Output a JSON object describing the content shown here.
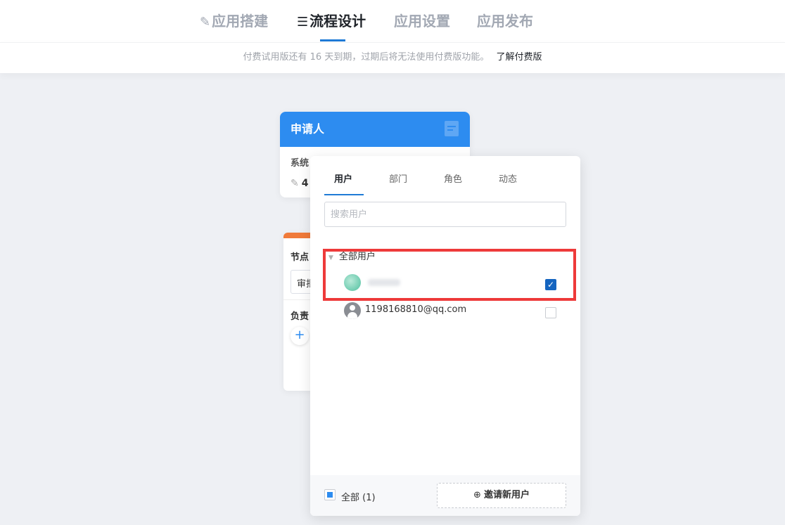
{
  "nav": {
    "tabs": [
      {
        "label": "应用搭建",
        "icon": "edit-icon",
        "active": false
      },
      {
        "label": "流程设计",
        "icon": "menu-icon",
        "active": true
      },
      {
        "label": "应用设置",
        "active": false
      },
      {
        "label": "应用发布",
        "active": false
      }
    ],
    "accent": "#1f7bd6"
  },
  "trial": {
    "message": "付费试用版还有 16 天到期，过期后将无法使用付费版功能。",
    "link": "了解付费版"
  },
  "applicant_card": {
    "title": "申请人",
    "line1": "系统",
    "line2": "4",
    "header_color": "#2d8cf0"
  },
  "node_card": {
    "label1": "节点",
    "box_value": "审批",
    "label2": "负责",
    "stripe_color": "#f07a3a"
  },
  "panel": {
    "tabs": [
      "用户",
      "部门",
      "角色",
      "动态"
    ],
    "active_tab": "用户",
    "search_placeholder": "搜索用户",
    "tree_root": "全部用户",
    "users": [
      {
        "name": "",
        "checked": true,
        "avatar": "green-avatar"
      },
      {
        "name": "1198168810@qq.com",
        "checked": false,
        "avatar": "default-user-avatar"
      }
    ],
    "footer": {
      "select_all_label": "全部 (1)",
      "invite_label": "邀请新用户",
      "invite_icon": "plus-circle-icon"
    }
  },
  "highlight_color": "#ee3a3a"
}
